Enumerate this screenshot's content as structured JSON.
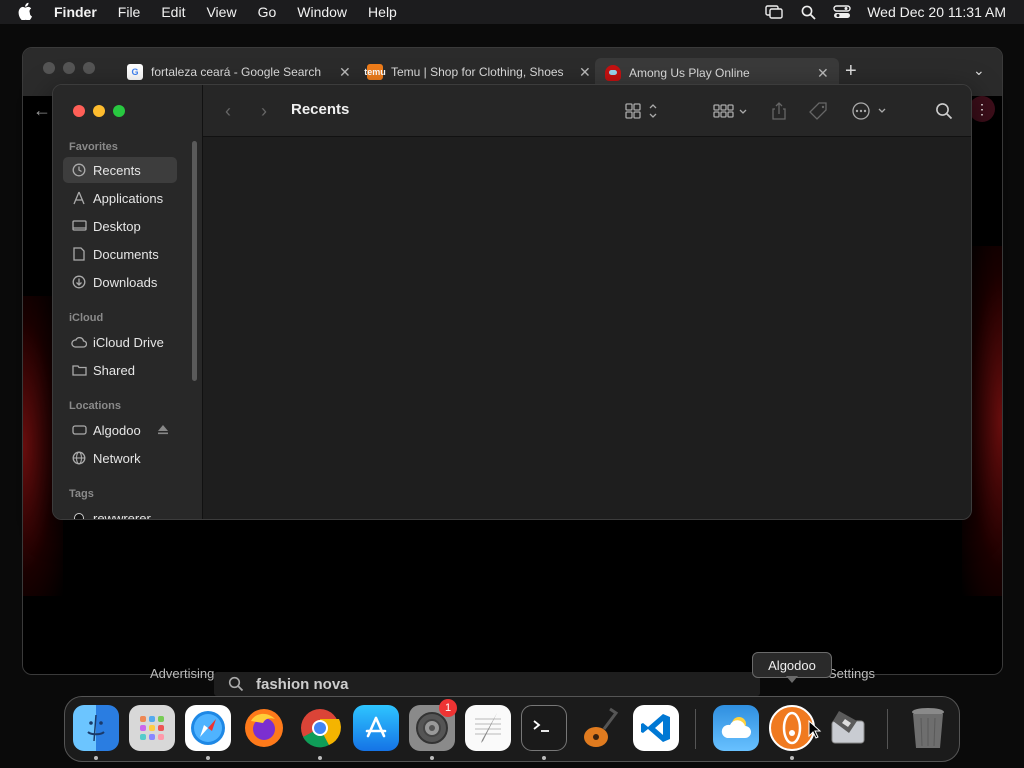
{
  "menubar": {
    "app_name": "Finder",
    "items": [
      "File",
      "Edit",
      "View",
      "Go",
      "Window",
      "Help"
    ],
    "clock": "Wed Dec 20  11:31 AM"
  },
  "browser": {
    "tabs": [
      {
        "title": "fortaleza ceará - Google Search",
        "favicon": "google-icon"
      },
      {
        "title": "Temu | Shop for Clothing, Shoes",
        "favicon": "temu-icon",
        "favicon_text": "temu"
      },
      {
        "title": "Among Us Play Online",
        "favicon": "among-us-icon"
      }
    ],
    "new_tab_label": "+",
    "page_bottom_left": "Advertising",
    "page_bottom_right": "Settings",
    "search_text": "fashion nova"
  },
  "finder": {
    "title": "Recents",
    "sidebar": {
      "favorites_label": "Favorites",
      "favorites": [
        {
          "label": "Recents",
          "icon": "clock-icon",
          "selected": true
        },
        {
          "label": "Applications",
          "icon": "applications-icon"
        },
        {
          "label": "Desktop",
          "icon": "desktop-icon"
        },
        {
          "label": "Documents",
          "icon": "document-icon"
        },
        {
          "label": "Downloads",
          "icon": "download-icon"
        }
      ],
      "icloud_label": "iCloud",
      "icloud": [
        {
          "label": "iCloud Drive",
          "icon": "cloud-icon"
        },
        {
          "label": "Shared",
          "icon": "shared-folder-icon"
        }
      ],
      "locations_label": "Locations",
      "locations": [
        {
          "label": "Algodoo",
          "icon": "drive-icon"
        },
        {
          "label": "Network",
          "icon": "globe-icon"
        }
      ],
      "tags_label": "Tags",
      "tags": [
        {
          "label": "rewwrerer"
        }
      ]
    }
  },
  "tooltip": "Algodoo",
  "dock": {
    "items": [
      {
        "name": "Finder",
        "icon": "finder-icon",
        "running": true
      },
      {
        "name": "Launchpad",
        "icon": "launchpad-icon"
      },
      {
        "name": "Safari",
        "icon": "safari-icon",
        "running": true
      },
      {
        "name": "Firefox",
        "icon": "firefox-icon"
      },
      {
        "name": "Chrome",
        "icon": "chrome-icon",
        "running": true
      },
      {
        "name": "App Store",
        "icon": "app-store-icon"
      },
      {
        "name": "System Settings",
        "icon": "settings-icon",
        "running": true,
        "badge": "1"
      },
      {
        "name": "TextEdit",
        "icon": "textedit-icon"
      },
      {
        "name": "Terminal",
        "icon": "terminal-icon",
        "running": true
      },
      {
        "name": "GarageBand",
        "icon": "garageband-icon"
      },
      {
        "name": "VS Code",
        "icon": "vscode-icon"
      },
      {
        "name": "Weather",
        "icon": "weather-icon"
      },
      {
        "name": "Algodoo",
        "icon": "algodoo-icon",
        "running": true
      },
      {
        "name": "Disk Utility",
        "icon": "disk-utility-icon"
      },
      {
        "name": "Trash",
        "icon": "trash-icon"
      }
    ]
  },
  "colors": {
    "close": "#ff5f57",
    "minimize": "#febc2e",
    "zoom": "#28c840",
    "badge": "#ee3333"
  }
}
